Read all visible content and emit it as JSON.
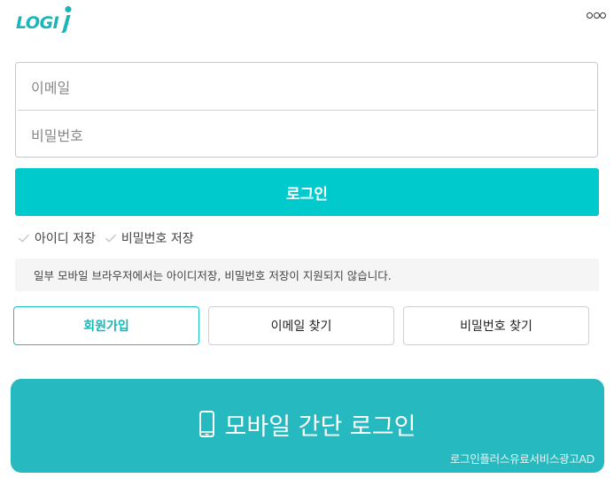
{
  "header": {
    "logo_text": "LOGI",
    "logo_mark": "i",
    "more_icon": "more-options-icon"
  },
  "login_form": {
    "email_placeholder": "이메일",
    "password_placeholder": "비밀번호",
    "login_label": "로그인"
  },
  "save_options": [
    {
      "label": "아이디 저장",
      "checked": false
    },
    {
      "label": "비밀번호 저장",
      "checked": false
    }
  ],
  "notice": "일부 모바일 브라우저에서는 아이디저장, 비밀번호 저장이 지원되지 않습니다.",
  "actions": {
    "signup": "회원가입",
    "find_email": "이메일 찾기",
    "find_password": "비밀번호 찾기"
  },
  "mobile_login": {
    "label": "모바일 간단 로그인",
    "icon": "phone-icon",
    "ad_label": "로그인플러스유료서비스광고AD"
  },
  "colors": {
    "brand": "#00cacb",
    "brand_dark": "#13b8ba",
    "mobile_bg": "#26b9bf"
  }
}
